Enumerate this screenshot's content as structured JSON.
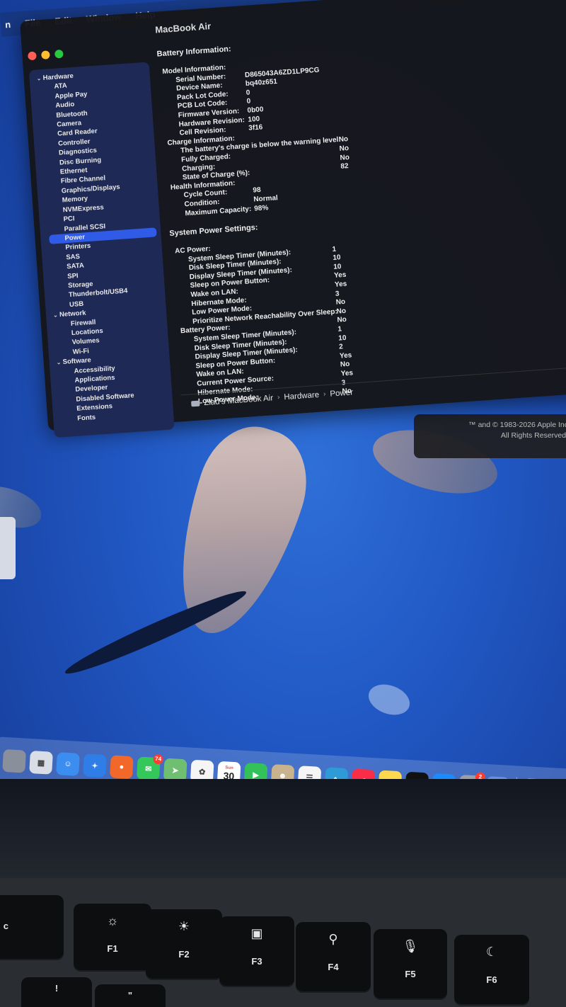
{
  "menubar": {
    "items": [
      "n",
      "File",
      "Edit",
      "Window",
      "Help"
    ]
  },
  "window": {
    "title": "MacBook Air",
    "sidebar": [
      {
        "label": "Hardware",
        "level": 0
      },
      {
        "label": "ATA",
        "level": 1
      },
      {
        "label": "Apple Pay",
        "level": 1
      },
      {
        "label": "Audio",
        "level": 1
      },
      {
        "label": "Bluetooth",
        "level": 1
      },
      {
        "label": "Camera",
        "level": 1
      },
      {
        "label": "Card Reader",
        "level": 1
      },
      {
        "label": "Controller",
        "level": 1
      },
      {
        "label": "Diagnostics",
        "level": 1
      },
      {
        "label": "Disc Burning",
        "level": 1
      },
      {
        "label": "Ethernet",
        "level": 1
      },
      {
        "label": "Fibre Channel",
        "level": 1
      },
      {
        "label": "Graphics/Displays",
        "level": 1
      },
      {
        "label": "Memory",
        "level": 1
      },
      {
        "label": "NVMExpress",
        "level": 1
      },
      {
        "label": "PCI",
        "level": 1
      },
      {
        "label": "Parallel SCSI",
        "level": 1
      },
      {
        "label": "Power",
        "level": 1,
        "selected": true
      },
      {
        "label": "Printers",
        "level": 1
      },
      {
        "label": "SAS",
        "level": 1
      },
      {
        "label": "SATA",
        "level": 1
      },
      {
        "label": "SPI",
        "level": 1
      },
      {
        "label": "Storage",
        "level": 1
      },
      {
        "label": "Thunderbolt/USB4",
        "level": 1
      },
      {
        "label": "USB",
        "level": 1
      },
      {
        "label": "Network",
        "level": 0
      },
      {
        "label": "Firewall",
        "level": 1
      },
      {
        "label": "Locations",
        "level": 1
      },
      {
        "label": "Volumes",
        "level": 1
      },
      {
        "label": "Wi-Fi",
        "level": 1
      },
      {
        "label": "Software",
        "level": 0
      },
      {
        "label": "Accessibility",
        "level": 1
      },
      {
        "label": "Applications",
        "level": 1
      },
      {
        "label": "Developer",
        "level": 1
      },
      {
        "label": "Disabled Software",
        "level": 1
      },
      {
        "label": "Extensions",
        "level": 1
      },
      {
        "label": "Fonts",
        "level": 1
      }
    ],
    "battery_title": "Battery Information:",
    "battery_rows": [
      {
        "key": "Model Information:",
        "value": "",
        "style": "l0"
      },
      {
        "key": "Serial Number:",
        "value": "D865043A6ZD1LP9CG",
        "style": "l1"
      },
      {
        "key": "Device Name:",
        "value": "bq40z651",
        "style": "l1"
      },
      {
        "key": "Pack Lot Code:",
        "value": "0",
        "style": "l1"
      },
      {
        "key": "PCB Lot Code:",
        "value": "0",
        "style": "l1"
      },
      {
        "key": "Firmware Version:",
        "value": "0b00",
        "style": "l1"
      },
      {
        "key": "Hardware Revision:",
        "value": "100",
        "style": "l1"
      },
      {
        "key": "Cell Revision:",
        "value": "3f16",
        "style": "l1"
      },
      {
        "key": "Charge Information:",
        "value": "",
        "style": "l0"
      },
      {
        "key": "The battery's charge is below the warning level:",
        "value": "No",
        "style": "charge"
      },
      {
        "key": "Fully Charged:",
        "value": "No",
        "style": "charge"
      },
      {
        "key": "Charging:",
        "value": "No",
        "style": "charge"
      },
      {
        "key": "State of Charge (%):",
        "value": "82",
        "style": "charge"
      },
      {
        "key": "Health Information:",
        "value": "",
        "style": "l0"
      },
      {
        "key": "Cycle Count:",
        "value": "98",
        "style": "l1"
      },
      {
        "key": "Condition:",
        "value": "Normal",
        "style": "l1"
      },
      {
        "key": "Maximum Capacity:",
        "value": "98%",
        "style": "l1"
      }
    ],
    "power_title": "System Power Settings:",
    "power_rows": [
      {
        "key": "AC Power:",
        "value": "",
        "style": "ps0"
      },
      {
        "key": "System Sleep Timer (Minutes):",
        "value": "1",
        "style": "ps1"
      },
      {
        "key": "Disk Sleep Timer (Minutes):",
        "value": "10",
        "style": "ps1"
      },
      {
        "key": "Display Sleep Timer (Minutes):",
        "value": "10",
        "style": "ps1"
      },
      {
        "key": "Sleep on Power Button:",
        "value": "Yes",
        "style": "ps1"
      },
      {
        "key": "Wake on LAN:",
        "value": "Yes",
        "style": "ps1"
      },
      {
        "key": "Hibernate Mode:",
        "value": "3",
        "style": "ps1"
      },
      {
        "key": "Low Power Mode:",
        "value": "No",
        "style": "ps1"
      },
      {
        "key": "Prioritize Network Reachability Over Sleep:",
        "value": "No",
        "style": "ps1"
      },
      {
        "key": "Battery Power:",
        "value": "No",
        "style": "ps0"
      },
      {
        "key": "System Sleep Timer (Minutes):",
        "value": "1",
        "style": "ps1"
      },
      {
        "key": "Disk Sleep Timer (Minutes):",
        "value": "10",
        "style": "ps1"
      },
      {
        "key": "Display Sleep Timer (Minutes):",
        "value": "2",
        "style": "ps1"
      },
      {
        "key": "Sleep on Power Button:",
        "value": "Yes",
        "style": "ps1"
      },
      {
        "key": "Wake on LAN:",
        "value": "No",
        "style": "ps1"
      },
      {
        "key": "Current Power Source:",
        "value": "Yes",
        "style": "ps1"
      },
      {
        "key": "Hibernate Mode:",
        "value": "3",
        "style": "ps1"
      },
      {
        "key": "Low Power Mode:",
        "value": "No",
        "style": "ps1"
      }
    ],
    "path": [
      "Ziad's MacBook Air",
      "Hardware",
      "Power"
    ]
  },
  "about_panel": {
    "line1": "™ and © 1983-2026 Apple Inc",
    "line2": "All Rights Reserved."
  },
  "dock": {
    "items": [
      {
        "name": "partial-app-icon",
        "label": "",
        "color": "#8a8f9c"
      },
      {
        "name": "launchpad-icon",
        "label": "▦",
        "color": "#d9dde6"
      },
      {
        "name": "finder-icon",
        "label": "☺",
        "color": "#3b8ef0"
      },
      {
        "name": "safari-icon",
        "label": "✦",
        "color": "#2f7de6"
      },
      {
        "name": "firefox-icon",
        "label": "●",
        "color": "#f2682a"
      },
      {
        "name": "messages-icon",
        "label": "✉",
        "color": "#34c759",
        "badge": "74"
      },
      {
        "name": "maps-icon",
        "label": "➤",
        "color": "#6fbf73"
      },
      {
        "name": "photos-icon",
        "label": "✿",
        "color": "#f5f5f5"
      },
      {
        "name": "calendar-icon",
        "label": "30",
        "sub": "Sun",
        "color": "#ffffff"
      },
      {
        "name": "facetime-icon",
        "label": "▶",
        "color": "#33c25a"
      },
      {
        "name": "contacts-icon",
        "label": "☻",
        "color": "#c9b38f"
      },
      {
        "name": "reminders-icon",
        "label": "☰",
        "color": "#f5f5f5"
      },
      {
        "name": "freeform-icon",
        "label": "∿",
        "color": "#2e9bd6"
      },
      {
        "name": "music-icon",
        "label": "♫",
        "color": "#fa2d48"
      },
      {
        "name": "notes-icon",
        "label": "≡",
        "color": "#ffd84d"
      },
      {
        "name": "tv-icon",
        "label": "tv",
        "color": "#111111"
      },
      {
        "name": "app-store-icon",
        "label": "A",
        "color": "#1a8cff"
      },
      {
        "name": "system-settings-icon",
        "label": "⚙",
        "color": "#9a9ea6",
        "badge": "2"
      },
      {
        "name": "preview-icon",
        "label": "▯",
        "color": "#6b8fd9"
      },
      {
        "name": "tips-icon",
        "label": "✪",
        "color": "#ffcc00"
      }
    ]
  },
  "keyboard": {
    "keys": [
      {
        "name": "key-c",
        "label": "c",
        "icon": ""
      },
      {
        "name": "key-f1",
        "label": "F1",
        "icon": "☼"
      },
      {
        "name": "key-f2",
        "label": "F2",
        "icon": "☀"
      },
      {
        "name": "key-f3",
        "label": "F3",
        "icon": "▣"
      },
      {
        "name": "key-f4",
        "label": "F4",
        "icon": "⚲"
      },
      {
        "name": "key-f5",
        "label": "F5",
        "icon": "🎙"
      },
      {
        "name": "key-f6",
        "label": "F6",
        "icon": "☾"
      }
    ],
    "row2": [
      "!",
      "\""
    ]
  }
}
